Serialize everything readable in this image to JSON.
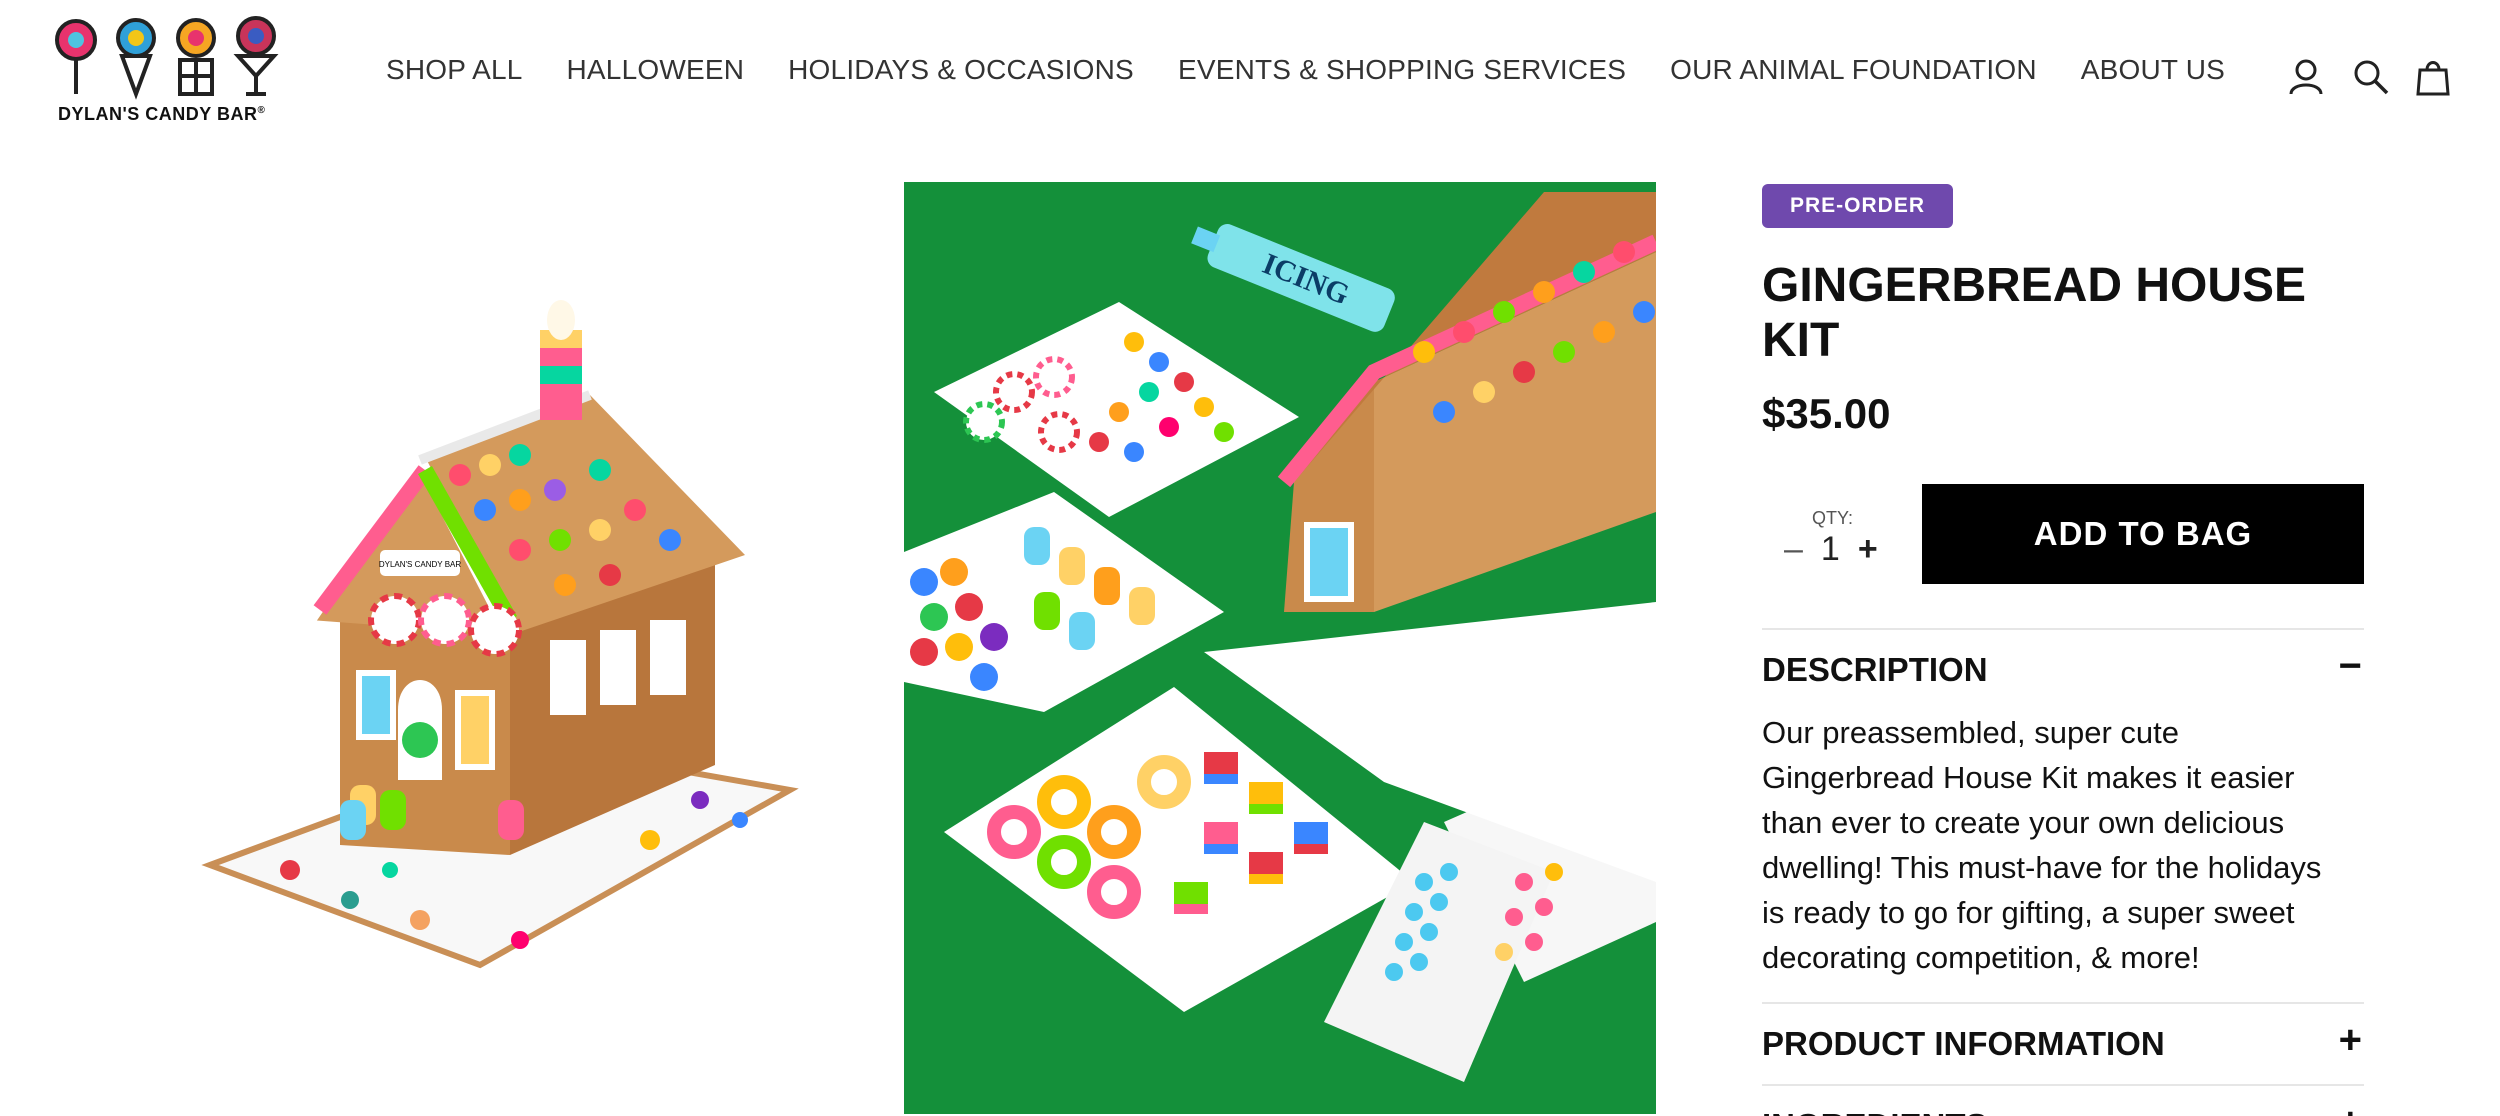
{
  "brand": {
    "name": "DYLAN'S CANDY BAR",
    "logo_mark": "®"
  },
  "nav": {
    "items": [
      "SHOP ALL",
      "HALLOWEEN",
      "HOLIDAYS & OCCASIONS",
      "EVENTS & SHOPPING SERVICES",
      "OUR ANIMAL FOUNDATION",
      "ABOUT US"
    ]
  },
  "header_icons": [
    "account-icon",
    "search-icon",
    "bag-icon"
  ],
  "gallery": {
    "main_image_text": "ICING",
    "house_sign_text": "DYLAN'S CANDY BAR"
  },
  "product": {
    "badge": "PRE-ORDER",
    "title": "GINGERBREAD HOUSE KIT",
    "price": "$35.00",
    "qty_label": "QTY:",
    "qty_minus": "–",
    "qty_value": "1",
    "qty_plus": "+",
    "add_to_bag": "ADD TO BAG"
  },
  "accordion": [
    {
      "label": "DESCRIPTION",
      "toggle": "−",
      "open": true,
      "body": "Our preassembled, super cute Gingerbread House Kit makes it easier than ever to create your own delicious dwelling! This must-have for the holidays is ready to go for gifting, a super sweet decorating competition, & more!"
    },
    {
      "label": "PRODUCT INFORMATION",
      "toggle": "+",
      "open": false
    },
    {
      "label": "INGREDIENTS",
      "toggle": "+",
      "open": false
    }
  ],
  "colors": {
    "badge": "#6f49ad",
    "button": "#000000",
    "green_backdrop": "#14903a"
  }
}
